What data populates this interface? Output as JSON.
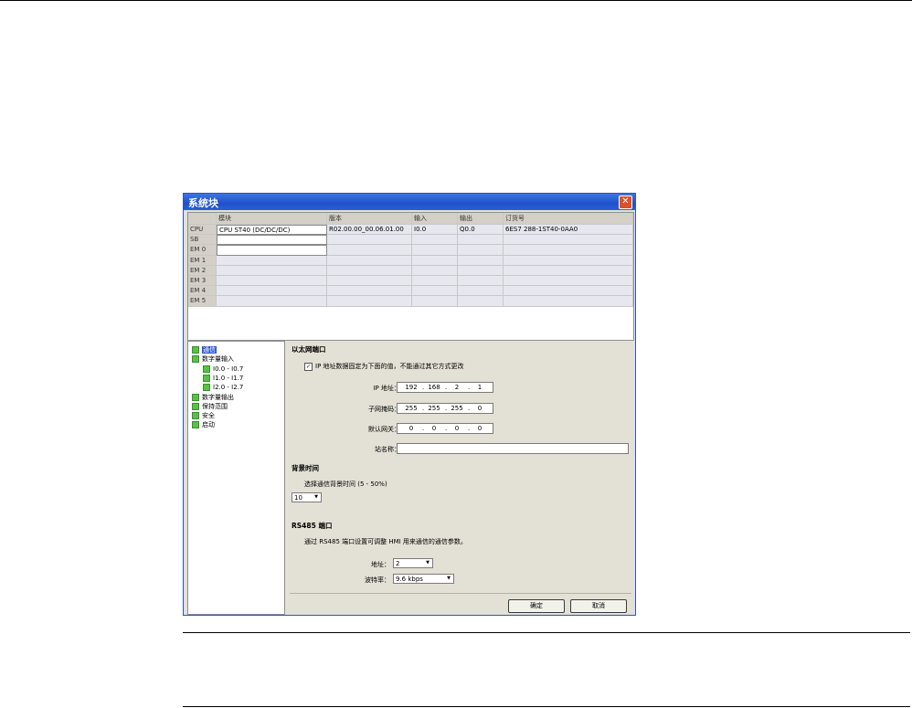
{
  "window": {
    "title": "系统块",
    "close_symbol": "✕"
  },
  "module_table": {
    "headers": [
      "",
      "模块",
      "版本",
      "输入",
      "输出",
      "订货号"
    ],
    "rows": [
      {
        "slot": "CPU",
        "module": "CPU ST40 (DC/DC/DC)",
        "version": "R02.00.00_00.06.01.00",
        "input": "I0.0",
        "output": "Q0.0",
        "order": "6ES7 288-1ST40-0AA0"
      },
      {
        "slot": "SB",
        "module": "",
        "version": "",
        "input": "",
        "output": "",
        "order": ""
      },
      {
        "slot": "EM 0",
        "module": "",
        "version": "",
        "input": "",
        "output": "",
        "order": ""
      },
      {
        "slot": "EM 1",
        "module": "",
        "version": "",
        "input": "",
        "output": "",
        "order": ""
      },
      {
        "slot": "EM 2",
        "module": "",
        "version": "",
        "input": "",
        "output": "",
        "order": ""
      },
      {
        "slot": "EM 3",
        "module": "",
        "version": "",
        "input": "",
        "output": "",
        "order": ""
      },
      {
        "slot": "EM 4",
        "module": "",
        "version": "",
        "input": "",
        "output": "",
        "order": ""
      },
      {
        "slot": "EM 5",
        "module": "",
        "version": "",
        "input": "",
        "output": "",
        "order": ""
      }
    ]
  },
  "tree": {
    "items": [
      {
        "label": "通信",
        "selected": true,
        "level": 0
      },
      {
        "label": "数字量输入",
        "selected": false,
        "level": 0
      },
      {
        "label": "I0.0 - I0.7",
        "selected": false,
        "level": 1
      },
      {
        "label": "I1.0 - I1.7",
        "selected": false,
        "level": 1
      },
      {
        "label": "I2.0 - I2.7",
        "selected": false,
        "level": 1
      },
      {
        "label": "数字量输出",
        "selected": false,
        "level": 0
      },
      {
        "label": "保持范围",
        "selected": false,
        "level": 0
      },
      {
        "label": "安全",
        "selected": false,
        "level": 0
      },
      {
        "label": "启动",
        "selected": false,
        "level": 0
      }
    ]
  },
  "ethernet": {
    "section_title": "以太网端口",
    "fixed_ip_checked": true,
    "fixed_ip_label": "IP 地址数据固定为下面的值，不能通过其它方式更改",
    "ip_label": "IP 地址：",
    "ip": [
      "192",
      "168",
      "2",
      "1"
    ],
    "subnet_label": "子网掩码：",
    "subnet": [
      "255",
      "255",
      "255",
      "0"
    ],
    "gateway_label": "默认网关：",
    "gateway": [
      "0",
      "0",
      "0",
      "0"
    ],
    "station_label": "站名称：",
    "station_value": ""
  },
  "background": {
    "section_title": "背景时间",
    "desc": "选择通信背景时间 (5 - 50%)",
    "value": "10"
  },
  "rs485": {
    "section_title": "RS485 端口",
    "desc": "通过 RS485 端口设置可调整 HMI 用来通信的通信参数。",
    "address_label": "地址：",
    "address_value": "2",
    "baud_label": "波特率：",
    "baud_value": "9.6 kbps"
  },
  "buttons": {
    "ok": "确定",
    "cancel": "取消"
  }
}
